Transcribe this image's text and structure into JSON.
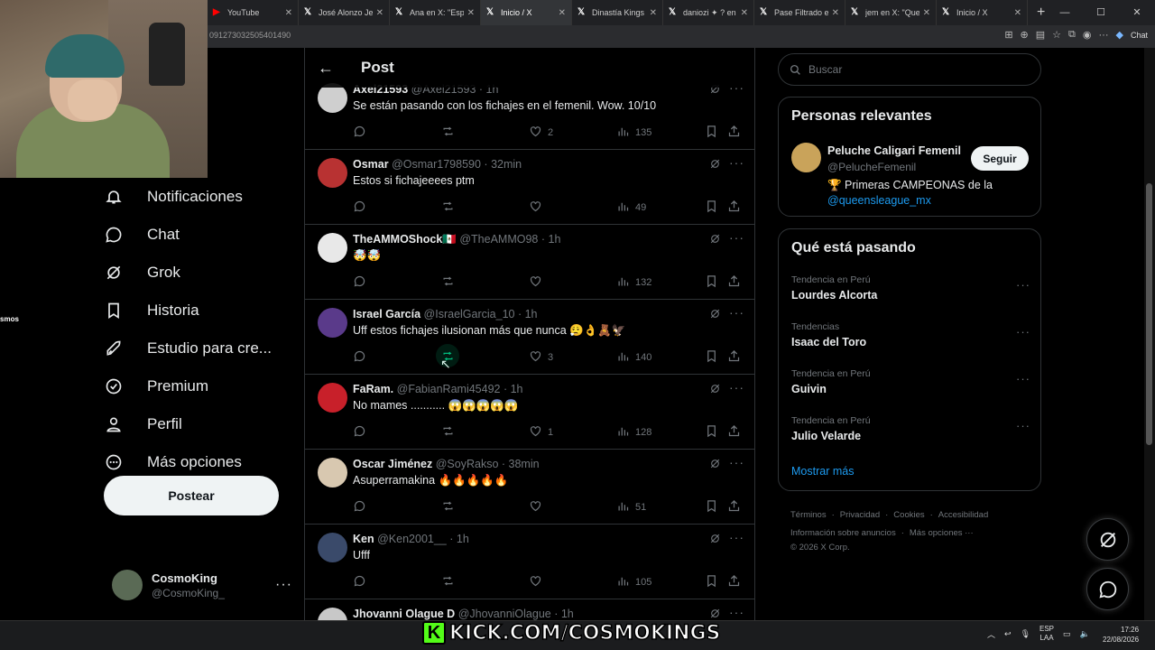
{
  "browser": {
    "tabs": [
      {
        "label": "YouTube",
        "icon": "youtube-icon",
        "active": false
      },
      {
        "label": "José Alonzo Jerí",
        "icon": "x-icon",
        "active": false
      },
      {
        "label": "Ana en X: \"Españ",
        "icon": "x-icon",
        "active": false
      },
      {
        "label": "Inicio / X",
        "icon": "x-icon",
        "active": true
      },
      {
        "label": "Dinastía Kings 👑",
        "icon": "x-icon",
        "active": false
      },
      {
        "label": "daniozi ✦ ? en",
        "icon": "x-icon",
        "active": false
      },
      {
        "label": "Pase Filtrado en",
        "icon": "x-icon",
        "active": false
      },
      {
        "label": "jem en X: \"Que h",
        "icon": "x-icon",
        "active": false
      },
      {
        "label": "Inicio / X",
        "icon": "x-icon",
        "active": false
      }
    ],
    "url": "091273032505401490",
    "chat_label": "Chat"
  },
  "overlay": {
    "side_text": "smos",
    "kick_text": "KICK.COM/COSMOKINGS",
    "kick_logo": "K"
  },
  "sidenav": {
    "items": [
      {
        "label": "Notificaciones",
        "icon": "bell-icon"
      },
      {
        "label": "Chat",
        "icon": "chat-bubble-icon"
      },
      {
        "label": "Grok",
        "icon": "grok-icon"
      },
      {
        "label": "Historia",
        "icon": "bookmark-icon"
      },
      {
        "label": "Estudio para cre...",
        "icon": "rocket-icon"
      },
      {
        "label": "Premium",
        "icon": "verified-badge-icon"
      },
      {
        "label": "Perfil",
        "icon": "person-icon"
      },
      {
        "label": "Más opciones",
        "icon": "more-circle-icon"
      }
    ],
    "post_button": "Postear",
    "profile": {
      "name": "CosmoKing",
      "handle": "@CosmoKing_",
      "more": "···"
    }
  },
  "main": {
    "back_icon": "←",
    "title": "Post",
    "tweets": [
      {
        "name": "Axel21593",
        "handle": "@Axel21593",
        "time": "1h",
        "text": "Se están pasando con los fichajes en el femenil. Wow. 10/10",
        "likes": "2",
        "views": "135",
        "avatar_color": "#cfcfcf"
      },
      {
        "name": "Osmar",
        "handle": "@Osmar1798590",
        "time": "32min",
        "text": "Estos si fichajeeees ptm",
        "likes": "",
        "views": "49",
        "avatar_color": "#b83232"
      },
      {
        "name": "TheAMMOShock🇲🇽",
        "handle": "@TheAMMO98",
        "time": "1h",
        "text": "🤯🤯",
        "likes": "",
        "views": "132",
        "avatar_color": "#e8e8e8"
      },
      {
        "name": "Israel García",
        "handle": "@IsraelGarcia_10",
        "time": "1h",
        "text": "Uff estos fichajes ilusionan más que nunca 😮‍💨👌🧸🦅",
        "likes": "3",
        "views": "140",
        "avatar_color": "#5a3a8a",
        "retweet_hover": true
      },
      {
        "name": "FaRam.",
        "handle": "@FabianRami45492",
        "time": "1h",
        "text": "No mames ........... 😱😱😱😱😱",
        "likes": "1",
        "views": "128",
        "avatar_color": "#c8202a"
      },
      {
        "name": "Oscar Jiménez",
        "handle": "@SoyRakso",
        "time": "38min",
        "text": "Asuperramakina 🔥🔥🔥🔥🔥",
        "likes": "",
        "views": "51",
        "avatar_color": "#d8c8b0"
      },
      {
        "name": "Ken",
        "handle": "@Ken2001__",
        "time": "1h",
        "text": "Ufff",
        "likes": "",
        "views": "105",
        "avatar_color": "#3a4a6a"
      },
      {
        "name": "Jhovanni Olague D",
        "handle": "@JhovanniOlague",
        "time": "1h",
        "text": "",
        "likes": "",
        "views": "",
        "avatar_color": "#c8c8c8"
      }
    ]
  },
  "right": {
    "search_placeholder": "Buscar",
    "relevant": {
      "title": "Personas relevantes",
      "name": "Peluche Caligari Femenil",
      "handle": "@PelucheFemenil",
      "follow_label": "Seguir",
      "bio": "🏆 Primeras CAMPEONAS de la",
      "bio_link": "@queensleague_mx"
    },
    "trends": {
      "title": "Qué está pasando",
      "items": [
        {
          "context": "Tendencia en Perú",
          "name": "Lourdes Alcorta"
        },
        {
          "context": "Tendencias",
          "name": "Isaac del Toro"
        },
        {
          "context": "Tendencia en Perú",
          "name": "Guivin"
        },
        {
          "context": "Tendencia en Perú",
          "name": "Julio Velarde"
        }
      ],
      "show_more": "Mostrar más"
    },
    "footer": {
      "links_row1": [
        "Términos",
        "Privacidad",
        "Cookies",
        "Accesibilidad"
      ],
      "links_row2": [
        "Información sobre anuncios",
        "Más opciones ···"
      ],
      "copyright": "© 2026 X Corp."
    }
  },
  "taskbar": {
    "lang_top": "ESP",
    "lang_bottom": "LAA",
    "time": "17:26",
    "date": "22/08/2026"
  }
}
